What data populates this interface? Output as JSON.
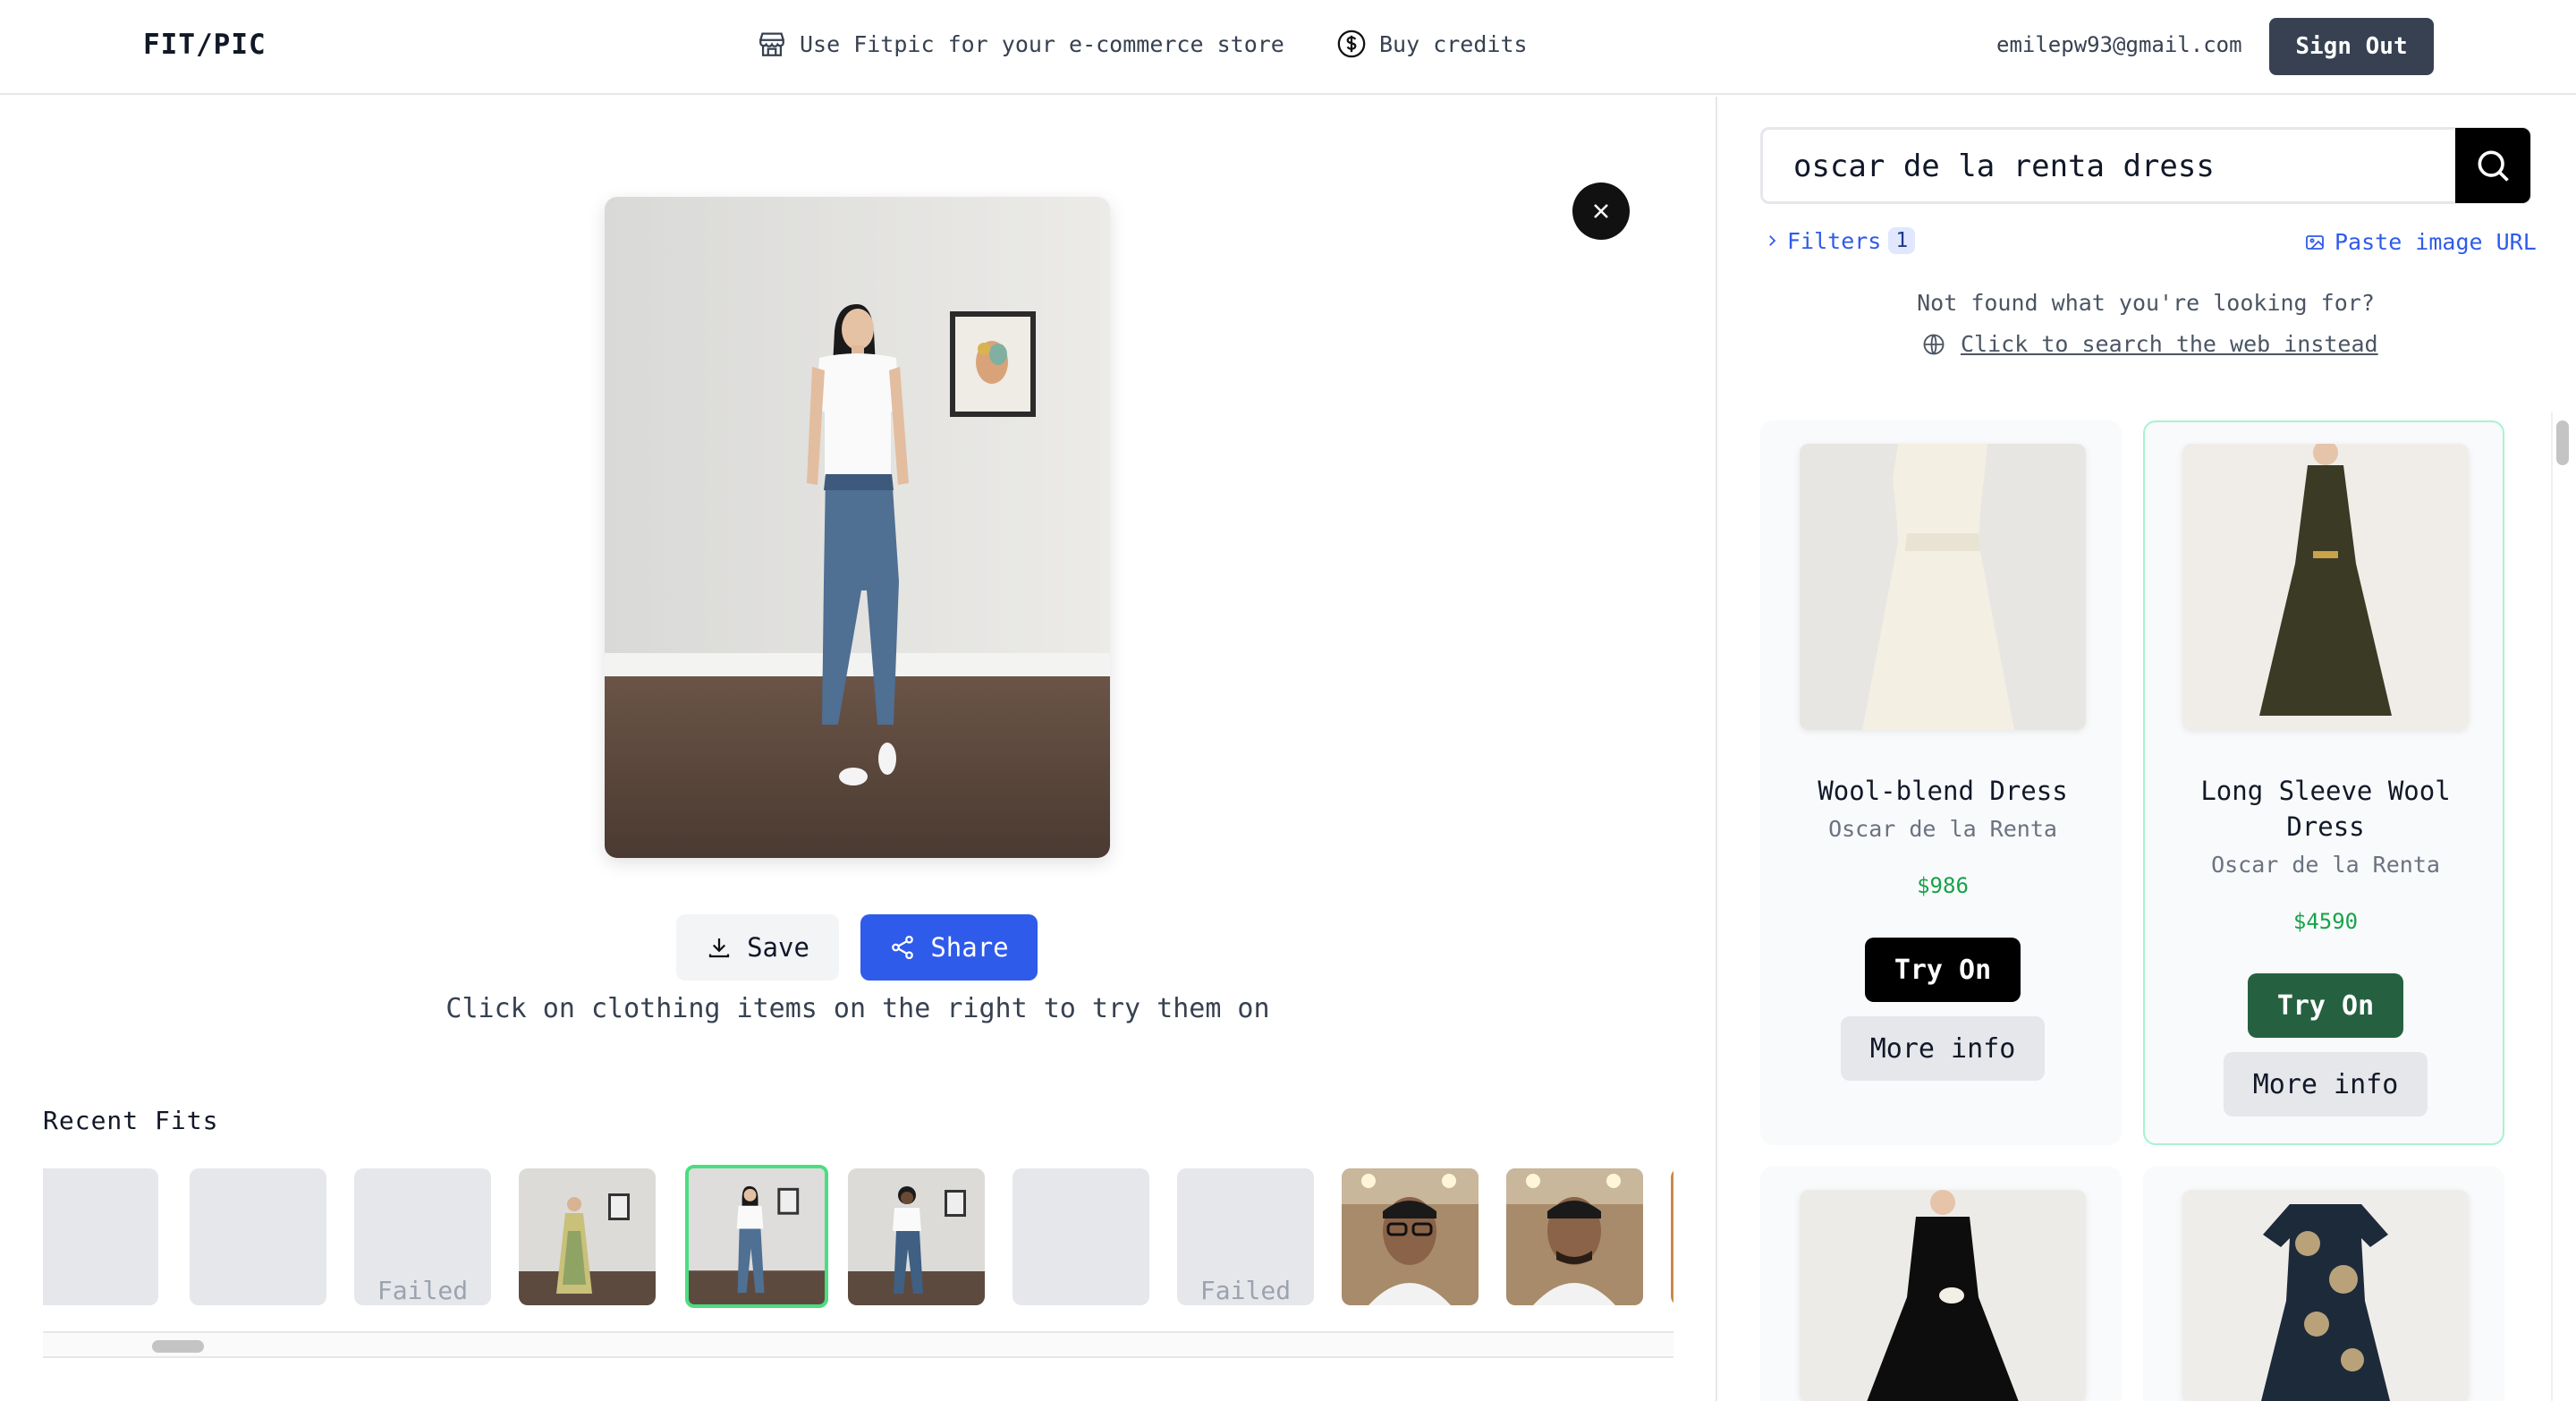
{
  "header": {
    "logo": "FIT/PIC",
    "store_link": "Use Fitpic for your e-commerce store",
    "credits_link": "Buy credits",
    "email": "emilepw93@gmail.com",
    "signout": "Sign Out"
  },
  "main": {
    "save_label": "Save",
    "share_label": "Share",
    "hint": "Click on clothing items on the right to try them on",
    "recent_title": "Recent Fits",
    "failed_label": "Failed"
  },
  "search": {
    "query": "oscar de la renta dress",
    "filters_label": "Filters",
    "filters_count": "1",
    "paste_label": "Paste image URL",
    "not_found": "Not found what you're looking for?",
    "web_search": "Click to search the web instead"
  },
  "products": [
    {
      "name": "Wool-blend Dress",
      "brand": "Oscar de la Renta",
      "price": "$986",
      "try_on": "Try On",
      "more_info": "More info"
    },
    {
      "name": "Long Sleeve Wool Dress",
      "brand": "Oscar de la Renta",
      "price": "$4590",
      "try_on": "Try On",
      "more_info": "More info"
    }
  ],
  "colors": {
    "accent_blue": "#2f5bea",
    "try_on_selected": "#256141",
    "price_green": "#16a34a",
    "signout_bg": "#374151"
  }
}
